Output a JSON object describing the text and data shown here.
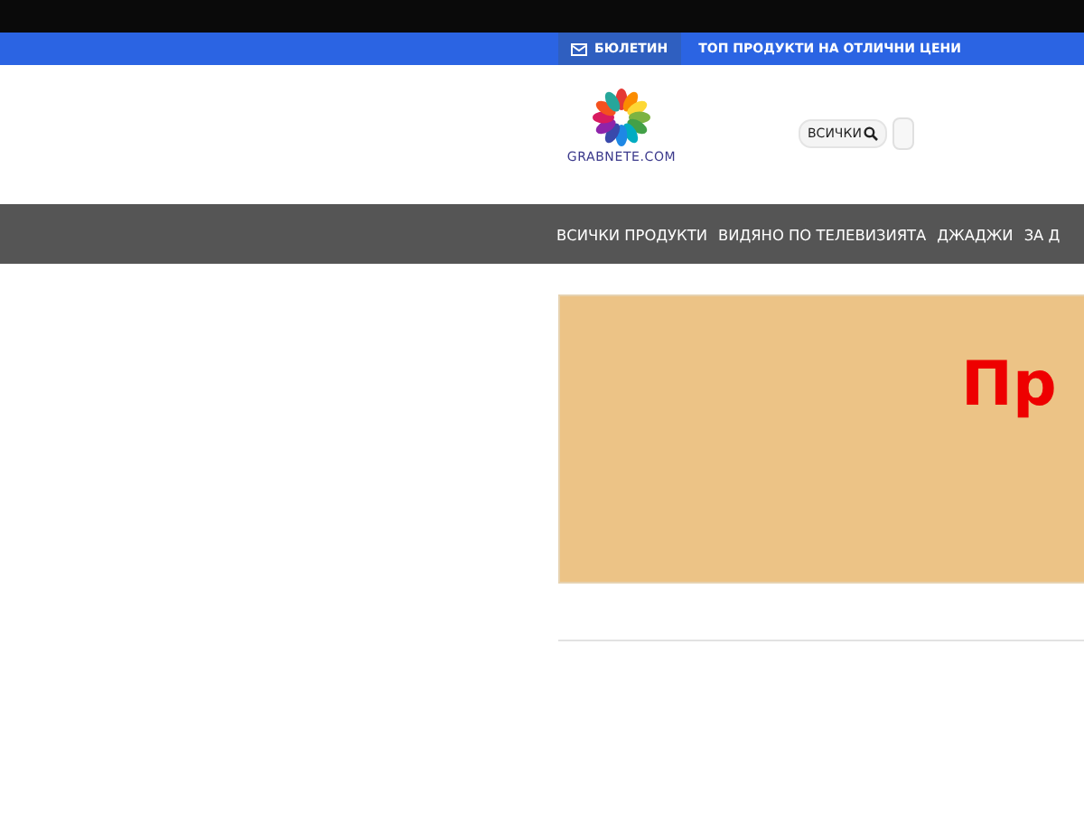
{
  "top_bar": {
    "newsletter": "БЮЛЕТИН",
    "promo": "ТОП ПРОДУКТИ НА ОТЛИЧНИ ЦЕНИ"
  },
  "header": {
    "logo_text": "GRABNETE.COM",
    "search": {
      "value": "ВСИЧКИ"
    }
  },
  "nav": {
    "items": [
      {
        "label": "ВСИЧКИ ПРОДУКТИ"
      },
      {
        "label": "ВИДЯНО ПО ТЕЛЕВИЗИЯТА"
      },
      {
        "label": "ДЖАДЖИ"
      },
      {
        "label": "ЗА Д"
      }
    ]
  },
  "banner": {
    "text": "Пр"
  }
}
